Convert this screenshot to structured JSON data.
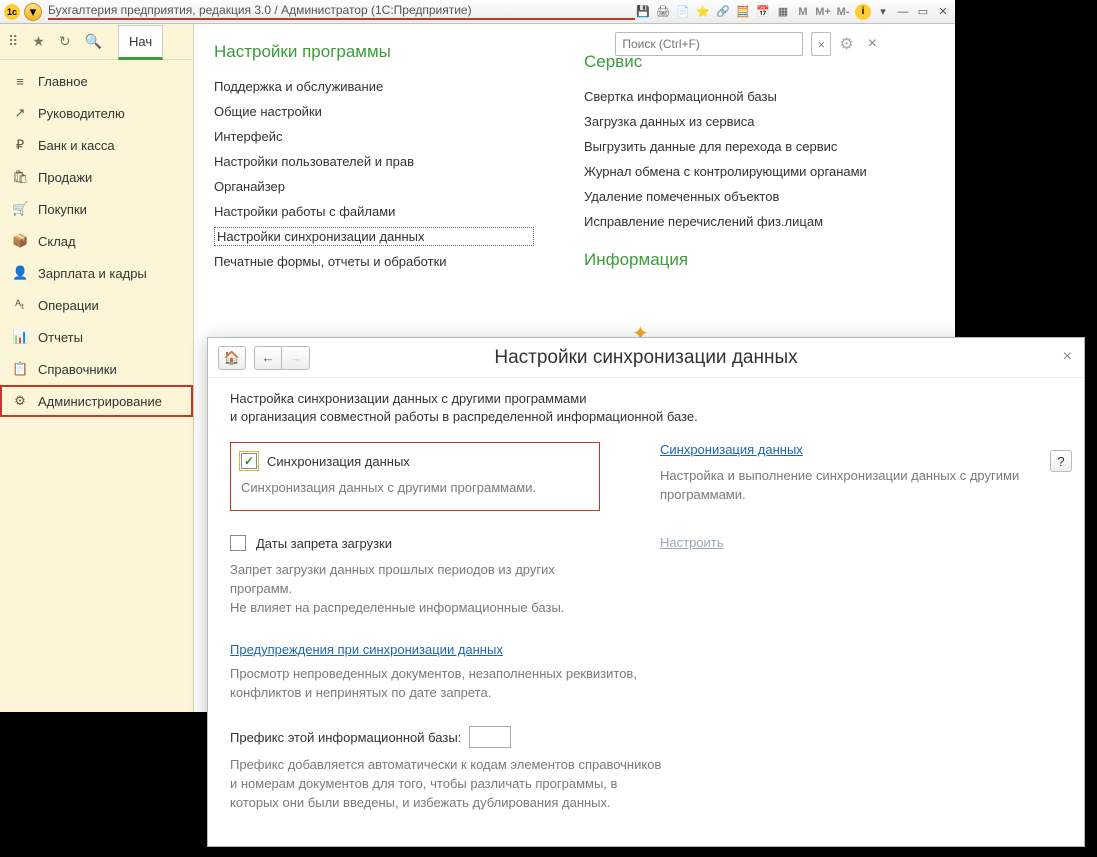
{
  "titlebar": {
    "title": "Бухгалтерия предприятия, редакция 3.0 / Администратор  (1С:Предприятие)",
    "m1": "M",
    "m2": "M+",
    "m3": "M-"
  },
  "tab_start": "Нач",
  "nav": [
    {
      "icon": "≡",
      "label": "Главное"
    },
    {
      "icon": "↗",
      "label": "Руководителю"
    },
    {
      "icon": "₽",
      "label": "Банк и касса"
    },
    {
      "icon": "🛍",
      "label": "Продажи"
    },
    {
      "icon": "🛒",
      "label": "Покупки"
    },
    {
      "icon": "📦",
      "label": "Склад"
    },
    {
      "icon": "👤",
      "label": "Зарплата и кадры"
    },
    {
      "icon": "ᴬₜ",
      "label": "Операции"
    },
    {
      "icon": "📊",
      "label": "Отчеты"
    },
    {
      "icon": "📋",
      "label": "Справочники"
    },
    {
      "icon": "⚙",
      "label": "Администрирование"
    }
  ],
  "search_placeholder": "Поиск (Ctrl+F)",
  "sections": {
    "settings_title": "Настройки программы",
    "settings_items": [
      "Поддержка и обслуживание",
      "Общие настройки",
      "Интерфейс",
      "Настройки пользователей и прав",
      "Органайзер",
      "Настройки работы с файлами",
      "Настройки синхронизации данных",
      "Печатные формы, отчеты и обработки"
    ],
    "service_title": "Сервис",
    "service_items": [
      "Свертка информационной базы",
      "Загрузка данных из сервиса",
      "Выгрузить данные для перехода в сервис",
      "Журнал обмена с контролирующими органами",
      "Удаление помеченных объектов",
      "Исправление перечислений физ.лицам"
    ],
    "info_title": "Информация"
  },
  "dialog": {
    "title": "Настройки синхронизации данных",
    "desc1": "Настройка синхронизации данных с другими программами",
    "desc2": "и организация совместной работы в распределенной информационной базе.",
    "help": "?",
    "sync_chk_label": "Синхронизация данных",
    "sync_gray": "Синхронизация данных с другими программами.",
    "sync_link": "Синхронизация данных",
    "sync_right_gray": "Настройка и выполнение синхронизации данных с другими программами.",
    "dates_chk_label": "Даты запрета загрузки",
    "dates_gray1": "Запрет загрузки данных прошлых периодов из других программ.",
    "dates_gray2": "Не влияет на распределенные информационные базы.",
    "dates_link": "Настроить",
    "warn_link": "Предупреждения при синхронизации данных",
    "warn_gray1": "Просмотр непроведенных документов, незаполненных реквизитов,",
    "warn_gray2": "конфликтов и непринятых по дате запрета.",
    "prefix_label": "Префикс этой информационной базы:",
    "prefix_gray1": "Префикс добавляется автоматически к кодам элементов справочников",
    "prefix_gray2": "и номерам документов для того, чтобы различать программы, в",
    "prefix_gray3": "которых они были введены, и избежать дублирования данных."
  }
}
